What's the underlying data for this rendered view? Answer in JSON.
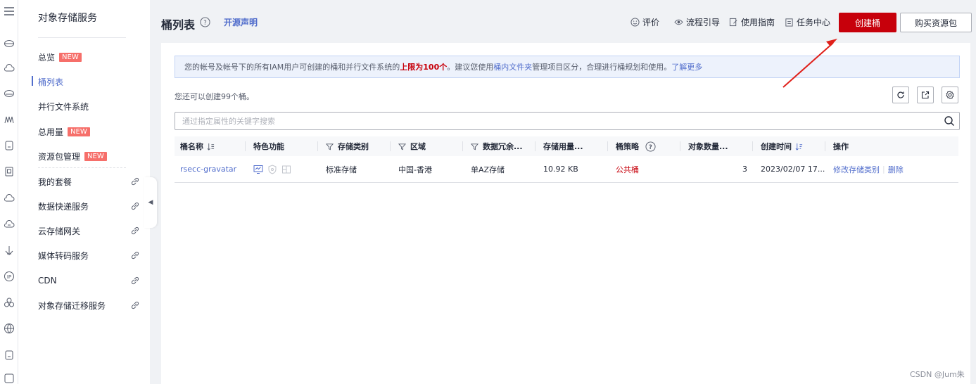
{
  "sidebar": {
    "title": "对象存储服务",
    "items": [
      {
        "label": "总览",
        "badge": "NEW"
      },
      {
        "label": "桶列表"
      },
      {
        "label": "并行文件系统"
      },
      {
        "label": "总用量",
        "badge": "NEW"
      },
      {
        "label": "资源包管理",
        "badge": "NEW"
      },
      {
        "label": "我的套餐"
      },
      {
        "label": "数据快递服务"
      },
      {
        "label": "云存储网关"
      },
      {
        "label": "媒体转码服务"
      },
      {
        "label": "CDN"
      },
      {
        "label": "对象存储迁移服务"
      }
    ]
  },
  "header": {
    "title": "桶列表",
    "open_source": "开源声明",
    "links": [
      "评价",
      "流程引导",
      "使用指南",
      "任务中心"
    ],
    "create_button": "创建桶",
    "buy_button": "购买资源包"
  },
  "notice": {
    "pre": "您的帐号及帐号下的所有IAM用户可创建的桶和并行文件系统的",
    "highlight": "上限为100个",
    "mid": "。建议您使用",
    "link1": "桶内文件夹",
    "post": "管理项目区分，合理进行桶规划和使用。",
    "link2": "了解更多"
  },
  "remaining": "您还可以创建99个桶。",
  "search": {
    "placeholder": "通过指定属性的关键字搜索"
  },
  "table": {
    "columns": [
      "桶名称",
      "特色功能",
      "存储类别",
      "区域",
      "数据冗余...",
      "存储用量...",
      "桶策略",
      "对象数量...",
      "创建时间",
      "操作"
    ],
    "rows": [
      {
        "name": "rsecc-gravatar",
        "storage_class": "标准存储",
        "region": "中国-香港",
        "redundancy": "单AZ存储",
        "usage": "10.92 KB",
        "policy": "公共桶",
        "objects": "3",
        "created": "2023/02/07 17...",
        "op_modify": "修改存储类别",
        "op_delete": "删除"
      }
    ]
  },
  "credit": "CSDN @Jum朱",
  "colors": {
    "accent": "#526ecc",
    "brand_red": "#c7000b",
    "badge": "#f66f6a"
  }
}
